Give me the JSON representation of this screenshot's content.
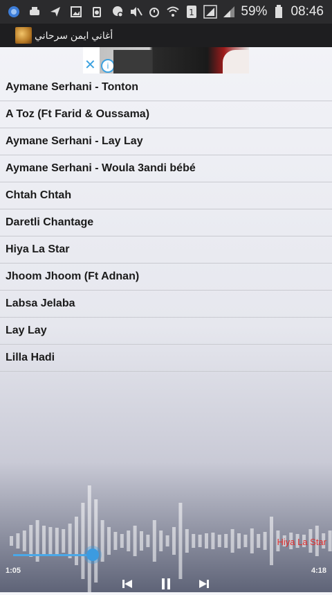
{
  "status_bar": {
    "battery_percent": "59%",
    "time": "08:46",
    "sim_slot": "1"
  },
  "app_bar": {
    "title": "أغاني ايمن سرحاني"
  },
  "ad": {
    "close_symbol": "✕",
    "info_symbol": "i"
  },
  "songs": [
    "Aymane Serhani - Tonton",
    "A Toz (Ft Farid & Oussama)",
    "Aymane Serhani - Lay Lay",
    "Aymane Serhani - Woula 3andi bébé",
    "Chtah Chtah",
    "Daretli Chantage",
    "Hiya La Star",
    "Jhoom Jhoom (Ft Adnan)",
    "Labsa Jelaba",
    "Lay Lay",
    "Lilla Hadi"
  ],
  "player": {
    "now_playing": "Hiya La Star",
    "elapsed": "1:05",
    "total": "4:18",
    "progress_fraction": 0.26
  },
  "colors": {
    "seek_accent": "#3c9be0",
    "now_playing_text": "#e0302f",
    "status_bar_bg": "#2b2b2d",
    "app_bar_bg": "#1e1e20"
  }
}
